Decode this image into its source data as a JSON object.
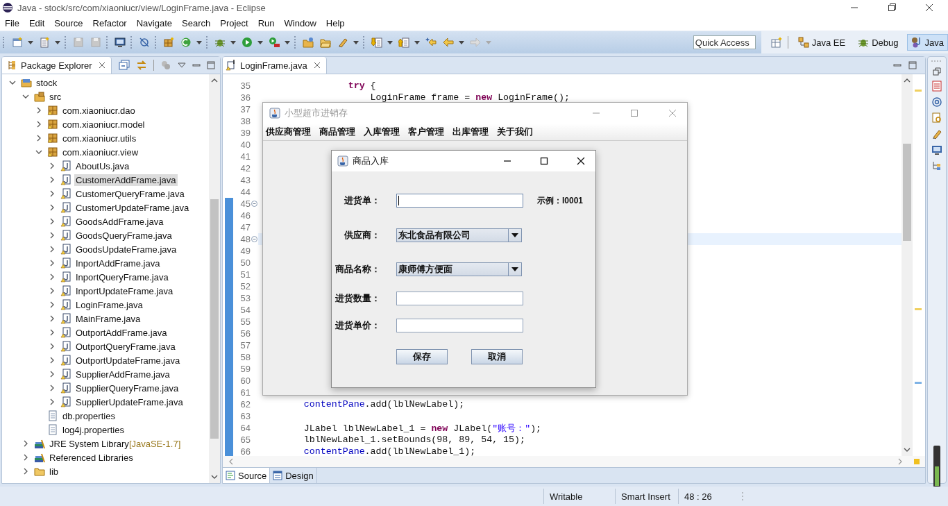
{
  "window": {
    "title": "Java - stock/src/com/xiaoniucr/view/LoginFrame.java - Eclipse"
  },
  "menu": [
    "File",
    "Edit",
    "Source",
    "Refactor",
    "Navigate",
    "Search",
    "Project",
    "Run",
    "Window",
    "Help"
  ],
  "quick_access": {
    "placeholder": "Quick Access"
  },
  "perspectives": [
    {
      "label": "Java EE",
      "kind": "javaee",
      "selected": false
    },
    {
      "label": "Debug",
      "kind": "debug",
      "selected": false
    },
    {
      "label": "Java",
      "kind": "java",
      "selected": true
    }
  ],
  "package_explorer": {
    "title": "Package Explorer",
    "tree": [
      {
        "label": "stock",
        "kind": "project",
        "expanded": true,
        "selected": false,
        "children": [
          {
            "label": "src",
            "kind": "source-folder",
            "expanded": true,
            "selected": false,
            "children": [
              {
                "label": "com.xiaoniucr.dao",
                "kind": "package",
                "expanded": false,
                "selected": false
              },
              {
                "label": "com.xiaoniucr.model",
                "kind": "package",
                "expanded": false,
                "selected": false
              },
              {
                "label": "com.xiaoniucr.utils",
                "kind": "package",
                "expanded": false,
                "selected": false
              },
              {
                "label": "com.xiaoniucr.view",
                "kind": "package",
                "expanded": true,
                "selected": false,
                "children": [
                  {
                    "label": "AboutUs.java",
                    "kind": "java",
                    "expanded": false,
                    "selected": false
                  },
                  {
                    "label": "CustomerAddFrame.java",
                    "kind": "java",
                    "expanded": false,
                    "selected": true
                  },
                  {
                    "label": "CustomerQueryFrame.java",
                    "kind": "java",
                    "expanded": false,
                    "selected": false
                  },
                  {
                    "label": "CustomerUpdateFrame.java",
                    "kind": "java",
                    "expanded": false,
                    "selected": false
                  },
                  {
                    "label": "GoodsAddFrame.java",
                    "kind": "java",
                    "expanded": false,
                    "selected": false
                  },
                  {
                    "label": "GoodsQueryFrame.java",
                    "kind": "java",
                    "expanded": false,
                    "selected": false
                  },
                  {
                    "label": "GoodsUpdateFrame.java",
                    "kind": "java",
                    "expanded": false,
                    "selected": false
                  },
                  {
                    "label": "InportAddFrame.java",
                    "kind": "java",
                    "expanded": false,
                    "selected": false
                  },
                  {
                    "label": "InportQueryFrame.java",
                    "kind": "java",
                    "expanded": false,
                    "selected": false
                  },
                  {
                    "label": "InportUpdateFrame.java",
                    "kind": "java",
                    "expanded": false,
                    "selected": false
                  },
                  {
                    "label": "LoginFrame.java",
                    "kind": "java",
                    "expanded": false,
                    "selected": false
                  },
                  {
                    "label": "MainFrame.java",
                    "kind": "java",
                    "expanded": false,
                    "selected": false
                  },
                  {
                    "label": "OutportAddFrame.java",
                    "kind": "java",
                    "expanded": false,
                    "selected": false
                  },
                  {
                    "label": "OutportQueryFrame.java",
                    "kind": "java",
                    "expanded": false,
                    "selected": false
                  },
                  {
                    "label": "OutportUpdateFrame.java",
                    "kind": "java",
                    "expanded": false,
                    "selected": false
                  },
                  {
                    "label": "SupplierAddFrame.java",
                    "kind": "java",
                    "expanded": false,
                    "selected": false
                  },
                  {
                    "label": "SupplierQueryFrame.java",
                    "kind": "java",
                    "expanded": false,
                    "selected": false
                  },
                  {
                    "label": "SupplierUpdateFrame.java",
                    "kind": "java",
                    "expanded": false,
                    "selected": false
                  }
                ]
              },
              {
                "label": "db.properties",
                "kind": "file",
                "selected": false
              },
              {
                "label": "log4j.properties",
                "kind": "file",
                "selected": false
              }
            ]
          },
          {
            "label": "JRE System Library",
            "decoration": "[JavaSE-1.7]",
            "kind": "library",
            "expanded": false,
            "selected": false
          },
          {
            "label": "Referenced Libraries",
            "kind": "library",
            "expanded": false,
            "selected": false
          },
          {
            "label": "lib",
            "kind": "folder",
            "expanded": false,
            "selected": false
          }
        ]
      }
    ]
  },
  "editor": {
    "tab": "LoginFrame.java",
    "lines": [
      {
        "number": "35",
        "current": false,
        "changed": false,
        "fold": false,
        "segments": [
          {
            "text": "                try",
            "kind": "keyword"
          },
          {
            "text": " {",
            "kind": "plain"
          }
        ]
      },
      {
        "number": "36",
        "current": false,
        "changed": false,
        "fold": false,
        "segments": [
          {
            "text": "                    LoginFrame frame = ",
            "kind": "plain"
          },
          {
            "text": "new",
            "kind": "keyword"
          },
          {
            "text": " LoginFrame();",
            "kind": "plain"
          }
        ]
      },
      {
        "number": "37",
        "current": false,
        "changed": false,
        "fold": false
      },
      {
        "number": "38",
        "current": false,
        "changed": false,
        "fold": false
      },
      {
        "number": "39",
        "current": false,
        "changed": false,
        "fold": false
      },
      {
        "number": "40",
        "current": false,
        "changed": false,
        "fold": false
      },
      {
        "number": "41",
        "current": false,
        "changed": false,
        "fold": false
      },
      {
        "number": "42",
        "current": false,
        "changed": false,
        "fold": false
      },
      {
        "number": "43",
        "current": false,
        "changed": false,
        "fold": false
      },
      {
        "number": "44",
        "current": false,
        "changed": false,
        "fold": false
      },
      {
        "number": "45",
        "current": false,
        "changed": true,
        "fold": true
      },
      {
        "number": "46",
        "current": false,
        "changed": true,
        "fold": false
      },
      {
        "number": "47",
        "current": false,
        "changed": true,
        "fold": false
      },
      {
        "number": "48",
        "current": true,
        "changed": true,
        "fold": true
      },
      {
        "number": "49",
        "current": false,
        "changed": true,
        "fold": false
      },
      {
        "number": "50",
        "current": false,
        "changed": true,
        "fold": false
      },
      {
        "number": "51",
        "current": false,
        "changed": true,
        "fold": false
      },
      {
        "number": "52",
        "current": false,
        "changed": true,
        "fold": false
      },
      {
        "number": "53",
        "current": false,
        "changed": true,
        "fold": false
      },
      {
        "number": "54",
        "current": false,
        "changed": true,
        "fold": false
      },
      {
        "number": "55",
        "current": false,
        "changed": true,
        "fold": false
      },
      {
        "number": "56",
        "current": false,
        "changed": true,
        "fold": false
      },
      {
        "number": "57",
        "current": false,
        "changed": true,
        "fold": false
      },
      {
        "number": "58",
        "current": false,
        "changed": true,
        "fold": false
      },
      {
        "number": "59",
        "current": false,
        "changed": true,
        "fold": false
      },
      {
        "number": "60",
        "current": false,
        "changed": true,
        "fold": false
      },
      {
        "number": "61",
        "current": false,
        "changed": true,
        "fold": false
      },
      {
        "number": "62",
        "current": false,
        "changed": true,
        "fold": false,
        "segments": [
          {
            "text": "        contentPane",
            "kind": "field"
          },
          {
            "text": ".add(lblNewLabel);",
            "kind": "plain"
          }
        ]
      },
      {
        "number": "63",
        "current": false,
        "changed": true,
        "fold": false
      },
      {
        "number": "64",
        "current": false,
        "changed": true,
        "fold": false,
        "segments": [
          {
            "text": "        JLabel lblNewLabel_1 = ",
            "kind": "plain"
          },
          {
            "text": "new",
            "kind": "keyword"
          },
          {
            "text": " JLabel(",
            "kind": "plain"
          },
          {
            "text": "\"账号：\"",
            "kind": "string"
          },
          {
            "text": ");",
            "kind": "plain"
          }
        ]
      },
      {
        "number": "65",
        "current": false,
        "changed": true,
        "fold": false,
        "segments": [
          {
            "text": "        lblNewLabel_1.setBounds(98, 89, 54, 15);",
            "kind": "plain"
          }
        ]
      },
      {
        "number": "66",
        "current": false,
        "changed": true,
        "fold": false,
        "segments": [
          {
            "text": "        contentPane",
            "kind": "field"
          },
          {
            "text": ".add(lblNewLabel_1);",
            "kind": "plain"
          }
        ]
      }
    ],
    "bottom_tabs": [
      {
        "label": "Source",
        "kind": "source",
        "selected": true
      },
      {
        "label": "Design",
        "kind": "design",
        "selected": false
      }
    ]
  },
  "app_frame": {
    "title": "小型超市进销存",
    "menu": [
      "供应商管理",
      "商品管理",
      "入库管理",
      "客户管理",
      "出库管理",
      "关于我们"
    ]
  },
  "dialog": {
    "title": "商品入库",
    "fields": [
      {
        "label": "进货单：",
        "kind": "text",
        "focused": true,
        "hint": "示例：I0001"
      },
      {
        "label": "供应商：",
        "kind": "combo",
        "value": "东北食品有限公司"
      },
      {
        "label": "商品名称：",
        "kind": "combo",
        "value": "康师傅方便面"
      },
      {
        "label": "进货数量：",
        "kind": "text",
        "focused": false
      },
      {
        "label": "进货单价：",
        "kind": "text",
        "focused": false
      }
    ],
    "buttons": [
      "保存",
      "取消"
    ]
  },
  "status_bar": [
    "Writable",
    "Smart Insert",
    "48 : 26"
  ]
}
